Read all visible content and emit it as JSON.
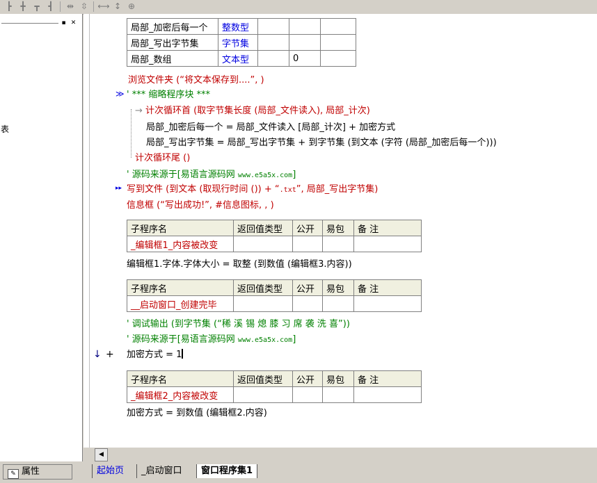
{
  "code": {
    "var_table_rows": [
      {
        "name": "局部_加密后每一个",
        "type": "整数型",
        "c3": "",
        "c4": "",
        "c5": ""
      },
      {
        "name": "局部_写出字节集",
        "type": "字节集",
        "c3": "",
        "c4": "",
        "c5": ""
      },
      {
        "name": "局部_数组",
        "type": "文本型",
        "c3": "",
        "c4": "0",
        "c5": ""
      }
    ],
    "lines": {
      "browse": "浏览文件夹 (“将文本保存到....”, )",
      "collapsed": "' *** 缩略程序块 ***",
      "loop_start": "计次循环首 (取字节集长度 (局部_文件读入), 局部_计次)",
      "loop_line1": "局部_加密后每一个 = 局部_文件读入 [局部_计次] + 加密方式",
      "loop_line2": "局部_写出字节集 = 局部_写出字节集 + 到字节集 (到文本 (字符 (局部_加密后每一个)))",
      "loop_end": "计次循环尾 ()",
      "source1_prefix": "' 源码来源于[易语言源码网 ",
      "source1_url": "www.e5a5x.com",
      "source1_suffix": "]",
      "write_file_a": "写到文件 (到文本 (取现行时间 ()) + “",
      "write_file_b": ".txt",
      "write_file_c": "”, 局部_写出字节集)",
      "msgbox": "信息框 (“写出成功!”, #信息图标, , )",
      "fontsize": "编辑框1.字体.字体大小 = 取整 (到数值 (编辑框3.内容))",
      "debug": "' 调试输出 (到字节集 (“稀 溪 锡 熄 膝 习 席 袭 洗 喜”))",
      "source2_prefix": "' 源码来源于[易语言源码网 ",
      "source2_url": "www.e5a5x.com",
      "source2_suffix": "]",
      "assign1": "加密方式 = 1",
      "assign2": "加密方式 = 到数值 (编辑框2.内容)"
    },
    "sub_header": {
      "name": "子程序名",
      "ret": "返回值类型",
      "pub": "公开",
      "easy": "易包",
      "note": "备 注"
    },
    "subs": [
      {
        "name": "_编辑框1_内容被改变"
      },
      {
        "name": "__启动窗口_创建完毕"
      },
      {
        "name": "_编辑框2_内容被改变"
      }
    ],
    "gutter_marks": {
      "arrow_down": "↓",
      "plus": "+",
      "collapse": "≫",
      "run": "▸▸"
    }
  },
  "left": {
    "fragment": "表"
  },
  "props_button": {
    "label": "属性"
  },
  "tabs": [
    {
      "label": "起始页"
    },
    {
      "label": "_启动窗口"
    },
    {
      "label": "窗口程序集1"
    }
  ],
  "colors": {
    "keyword": "#c00000",
    "type": "#0000e0",
    "comment": "#008000",
    "accent": "#000080"
  }
}
